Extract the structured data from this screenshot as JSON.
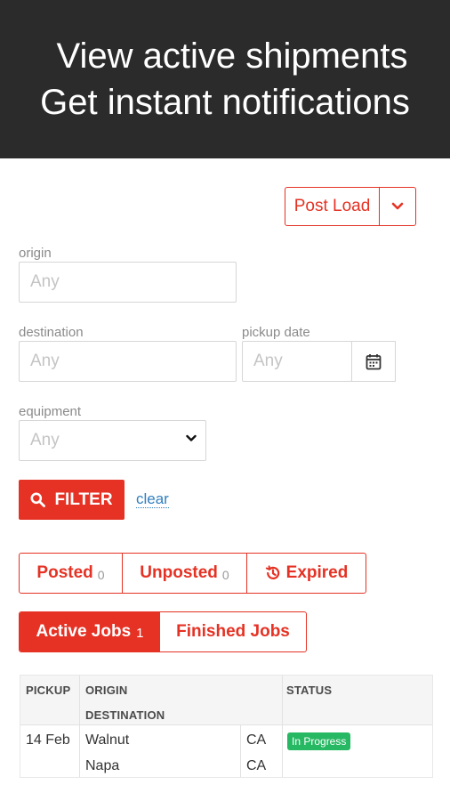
{
  "banner": {
    "line1": "View active shipments",
    "line2": "Get instant notifications"
  },
  "post_load": {
    "label": "Post Load",
    "caret_icon": "chevron-down-icon"
  },
  "filters": {
    "origin": {
      "label": "origin",
      "placeholder": "Any"
    },
    "destination": {
      "label": "destination",
      "placeholder": "Any"
    },
    "pickup_date": {
      "label": "pickup date",
      "placeholder": "Any",
      "icon": "calendar-icon"
    },
    "equipment": {
      "label": "equipment",
      "selected": "Any"
    },
    "filter_button": "FILTER",
    "clear_link": "clear"
  },
  "post_tabs": [
    {
      "label": "Posted",
      "count": "0"
    },
    {
      "label": "Unposted",
      "count": "0"
    },
    {
      "label": "Expired",
      "icon": "history-icon"
    }
  ],
  "job_tabs": [
    {
      "label": "Active Jobs",
      "count": "1",
      "active": true
    },
    {
      "label": "Finished Jobs",
      "active": false
    }
  ],
  "table": {
    "headers": {
      "pickup": "PICKUP",
      "origin": "ORIGIN",
      "destination": "DESTINATION",
      "status": "STATUS"
    },
    "rows": [
      {
        "pickup": "14 Feb",
        "origin_city": "Walnut",
        "origin_state": "CA",
        "dest_city": "Napa",
        "dest_state": "CA",
        "status": "In Progress"
      }
    ]
  },
  "colors": {
    "accent": "#e53224",
    "banner_bg": "#2b2b2b",
    "status_green": "#27b863",
    "link": "#2f7fbf"
  }
}
